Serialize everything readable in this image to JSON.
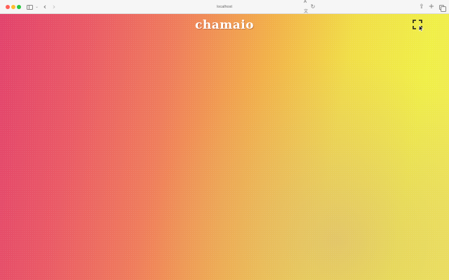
{
  "browser": {
    "url": "localhost",
    "controls": {
      "sidebar_chevron": "⌄",
      "back": "‹",
      "forward": "›",
      "translate": "A文",
      "reload": "↻",
      "share": "⇪",
      "new_tab": "+"
    },
    "icons": [
      "close-icon",
      "minimize-icon",
      "maximize-icon",
      "sidebar-icon",
      "tabs-overview-icon"
    ]
  },
  "page": {
    "logo": "chamaio",
    "background_colors": [
      "#e2436c",
      "#ef7d5c",
      "#f2b04a",
      "#f0ef48"
    ]
  }
}
